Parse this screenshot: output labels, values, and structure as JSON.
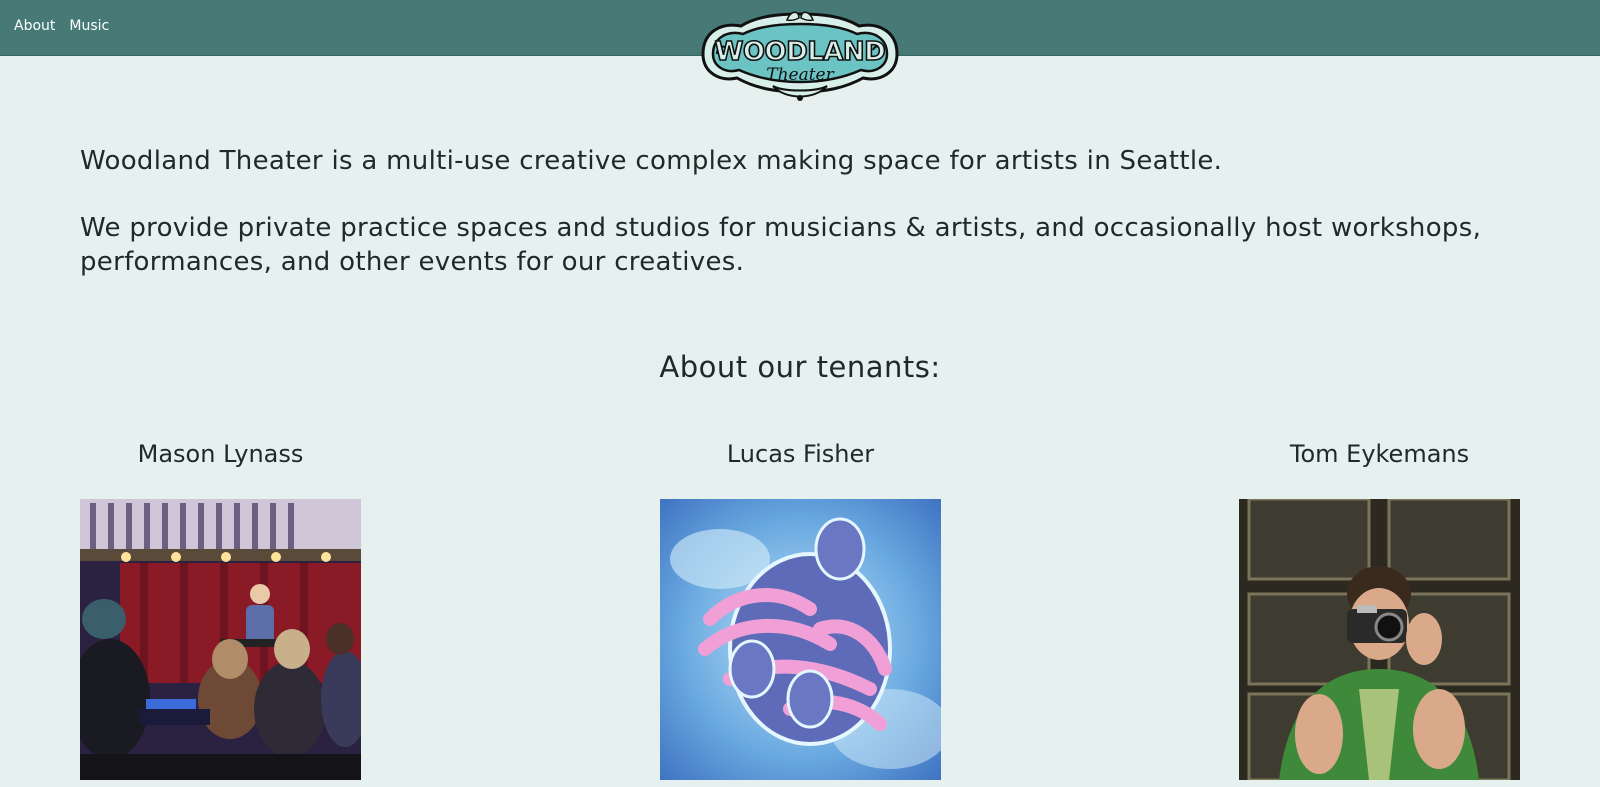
{
  "nav": {
    "items": [
      {
        "label": "About"
      },
      {
        "label": "Music"
      }
    ]
  },
  "logo": {
    "line1": "WOODLAND",
    "line2": "Theater",
    "colors": {
      "fill": "#6cc3c4",
      "outline": "#111111",
      "cream": "#d8efe9"
    }
  },
  "intro": {
    "paragraph1": "Woodland Theater is a multi-use creative complex making space for artists in Seattle.",
    "paragraph2": "We provide private practice spaces and studios for musicians & artists, and occasionally host workshops, performances, and other events for our creatives."
  },
  "tenants": {
    "heading": "About our tenants:",
    "items": [
      {
        "name": "Mason Lynass"
      },
      {
        "name": "Lucas Fisher"
      },
      {
        "name": "Tom Eykemans"
      }
    ]
  },
  "colors": {
    "header": "#477a77",
    "background": "#e6f0ee",
    "text": "#1e2a28"
  }
}
